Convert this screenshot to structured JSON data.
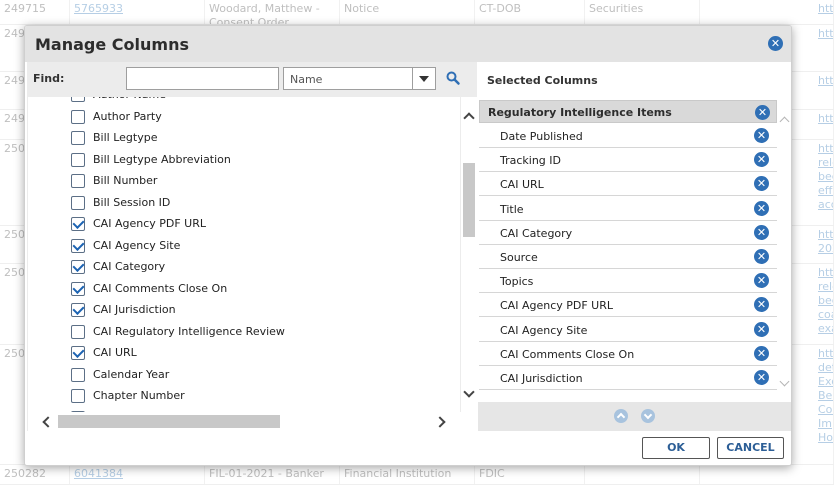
{
  "background_table": {
    "rows": [
      {
        "id": "249715",
        "link": "5765933",
        "name": "Woodard, Matthew - Consent Order",
        "type": "Notice",
        "agency": "CT-DOB",
        "category": "Securities",
        "url": "http"
      },
      {
        "id": "249",
        "link": "",
        "name": "",
        "type": "",
        "agency": "",
        "category": "",
        "url": "http"
      },
      {
        "id": "249",
        "link": "",
        "name": "",
        "type": "",
        "agency": "",
        "category": "",
        "url": "http"
      },
      {
        "id": "249",
        "link": "",
        "name": "",
        "type": "",
        "agency": "",
        "category": "",
        "url": "http"
      },
      {
        "id": "250",
        "link": "",
        "name": "",
        "type": "",
        "agency": "",
        "category": "",
        "url": "http rele bec effe acc"
      },
      {
        "id": "250",
        "link": "",
        "name": "",
        "type": "",
        "agency": "",
        "category": "",
        "url": "http 202"
      },
      {
        "id": "250",
        "link": "",
        "name": "",
        "type": "",
        "agency": "",
        "category": "",
        "url": "http rele bec coa exa"
      },
      {
        "id": "250",
        "link": "",
        "name": "",
        "type": "",
        "agency": "",
        "category": "",
        "url": "http det Exc Bec Cor Imp Hol"
      },
      {
        "id": "250282",
        "link": "6041384",
        "name": "FIL-01-2021 - Banker",
        "type": "Financial Institution",
        "agency": "FDIC",
        "category": "",
        "url": ""
      }
    ]
  },
  "dialog": {
    "title": "Manage Columns",
    "find": {
      "label": "Find:",
      "value": "",
      "field_select": "Name"
    },
    "available_columns": [
      {
        "label": "Author Name",
        "checked": false
      },
      {
        "label": "Author Party",
        "checked": false
      },
      {
        "label": "Bill Legtype",
        "checked": false
      },
      {
        "label": "Bill Legtype Abbreviation",
        "checked": false
      },
      {
        "label": "Bill Number",
        "checked": false
      },
      {
        "label": "Bill Session ID",
        "checked": false
      },
      {
        "label": "CAI Agency PDF URL",
        "checked": true
      },
      {
        "label": "CAI Agency Site",
        "checked": true
      },
      {
        "label": "CAI Category",
        "checked": true
      },
      {
        "label": "CAI Comments Close On",
        "checked": true
      },
      {
        "label": "CAI Jurisdiction",
        "checked": true
      },
      {
        "label": "CAI Regulatory Intelligence Review",
        "checked": false
      },
      {
        "label": "CAI URL",
        "checked": true
      },
      {
        "label": "Calendar Year",
        "checked": false
      },
      {
        "label": "Chapter Number",
        "checked": false
      },
      {
        "label": "",
        "checked": false
      }
    ],
    "selected": {
      "heading": "Selected Columns",
      "group": "Regulatory Intelligence Items",
      "items": [
        "Date Published",
        "Tracking ID",
        "CAI URL",
        "Title",
        "CAI Category",
        "Source",
        "Topics",
        "CAI Agency PDF URL",
        "CAI Agency Site",
        "CAI Comments Close On",
        "CAI Jurisdiction"
      ]
    },
    "buttons": {
      "ok": "OK",
      "cancel": "CANCEL"
    },
    "icons": {
      "close": "close-icon",
      "search": "search-icon",
      "remove": "remove-circle-icon",
      "move_up": "arrow-up-circle-icon",
      "move_down": "arrow-down-circle-icon"
    },
    "colors": {
      "accent": "#2f6fb5",
      "header_bg": "#e3e3e3",
      "group_bg": "#d9d9d9"
    }
  }
}
